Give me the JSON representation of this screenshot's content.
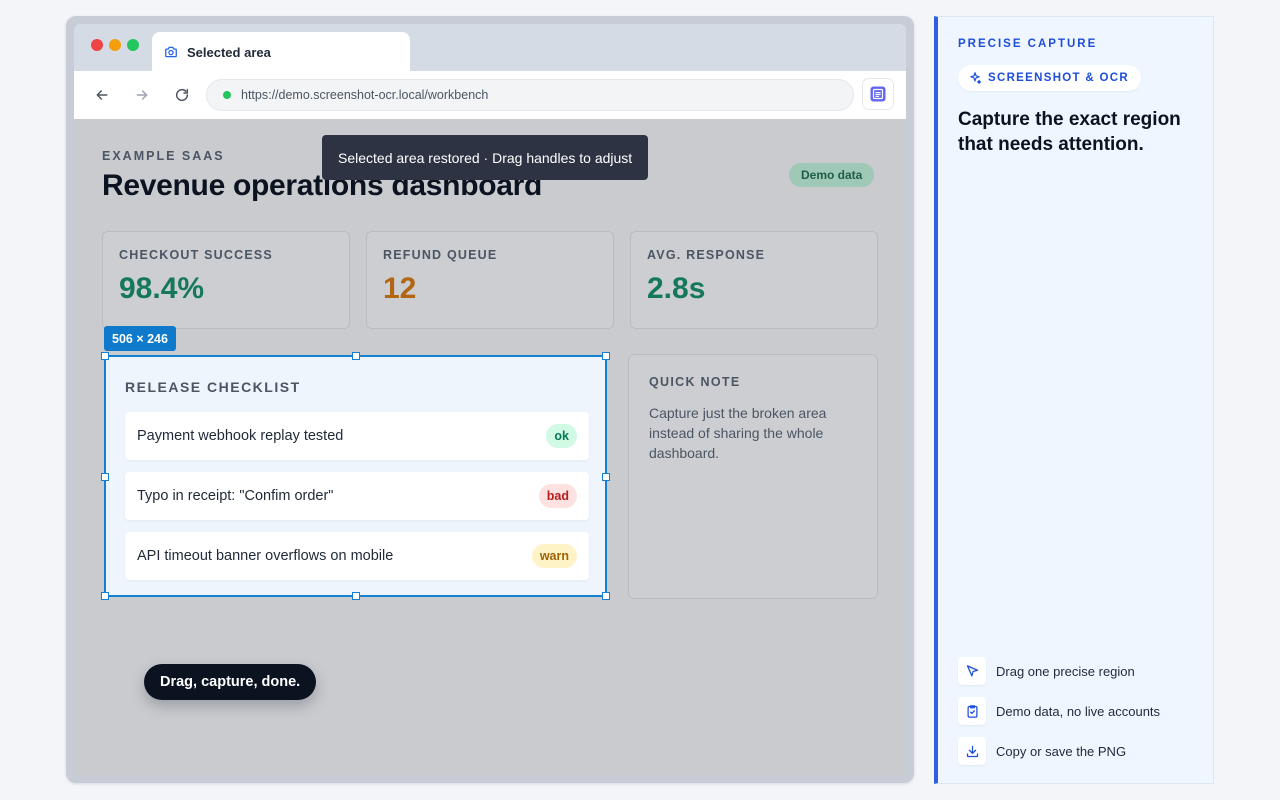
{
  "browser": {
    "tab_title": "Selected area",
    "url": "https://demo.screenshot-ocr.local/workbench"
  },
  "page": {
    "eyebrow": "EXAMPLE SAAS",
    "title": "Revenue operations dashboard",
    "demo_badge": "Demo data",
    "toast": "Selected area restored · Drag handles to adjust",
    "stats": [
      {
        "label": "CHECKOUT SUCCESS",
        "value": "98.4%",
        "color": "#15785a"
      },
      {
        "label": "REFUND QUEUE",
        "value": "12",
        "color": "#b26512"
      },
      {
        "label": "AVG. RESPONSE",
        "value": "2.8s",
        "color": "#15785a"
      }
    ],
    "selection": {
      "size_label": "506 × 246",
      "title": "RELEASE CHECKLIST",
      "items": [
        {
          "text": "Payment webhook replay tested",
          "status": "ok"
        },
        {
          "text": "Typo in receipt: \"Confim order\"",
          "status": "bad"
        },
        {
          "text": "API timeout banner overflows on mobile",
          "status": "warn"
        }
      ]
    },
    "note": {
      "title": "QUICK NOTE",
      "text": "Capture just the broken area instead of sharing the whole dashboard."
    },
    "tip": "Drag, capture, done."
  },
  "side_panel": {
    "eyebrow": "PRECISE CAPTURE",
    "chip_label": "SCREENSHOT & OCR",
    "heading": "Capture the exact region that needs attention.",
    "features": [
      {
        "icon": "cursor-icon",
        "label": "Drag one precise region"
      },
      {
        "icon": "clipboard-check-icon",
        "label": "Demo data, no live accounts"
      },
      {
        "icon": "download-icon",
        "label": "Copy or save the PNG"
      }
    ],
    "accent_color": "#2f5ee0"
  }
}
